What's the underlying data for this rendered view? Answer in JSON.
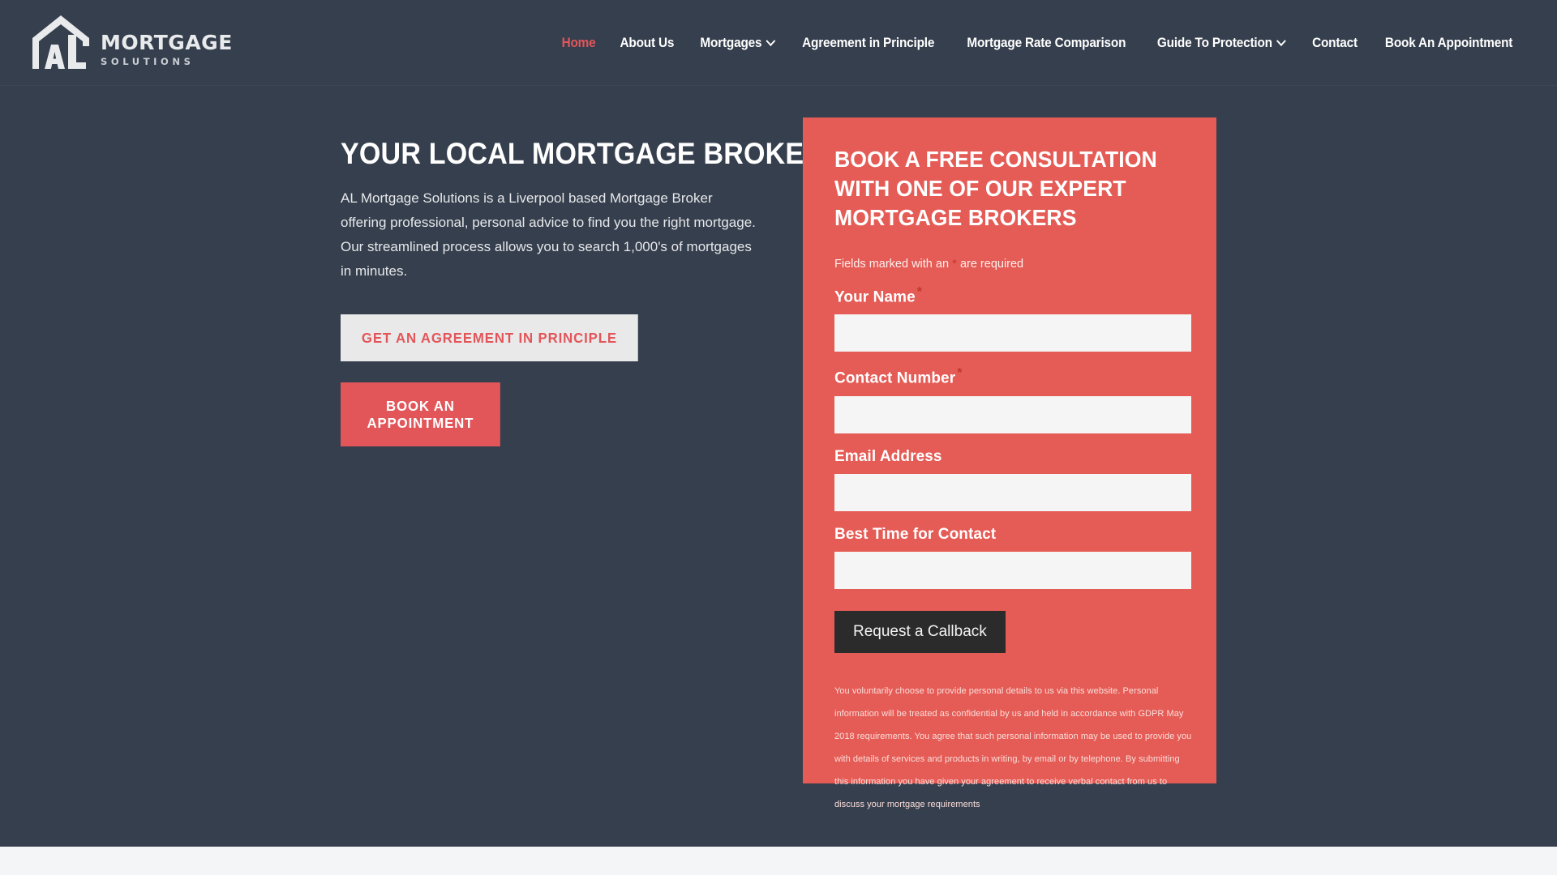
{
  "brand": {
    "logo_icon": "house-outline-al-monogram-icon",
    "name": "MORTGAGE",
    "tagline": "SOLUTIONS",
    "accent_color": "#e2565a",
    "panel_color": "#e55b55",
    "dark_color": "#363f4d"
  },
  "nav": {
    "items": [
      {
        "label": "Home",
        "active": true,
        "has_dropdown": false
      },
      {
        "label": "About Us",
        "active": false,
        "has_dropdown": false
      },
      {
        "label": "Mortgages",
        "active": false,
        "has_dropdown": true
      },
      {
        "label": "Agreement in Principle",
        "active": false,
        "has_dropdown": false
      },
      {
        "label": "Mortgage Rate Comparison",
        "active": false,
        "has_dropdown": false
      },
      {
        "label": "Guide To Protection",
        "active": false,
        "has_dropdown": true
      },
      {
        "label": "Contact",
        "active": false,
        "has_dropdown": false
      },
      {
        "label": "Book An Appointment",
        "active": false,
        "has_dropdown": false
      }
    ]
  },
  "hero": {
    "title": "YOUR LOCAL MORTGAGE BROKER",
    "paragraph": "AL Mortgage Solutions is a Liverpool based Mortgage Broker offering professional, personal advice to find you the right mortgage. Our streamlined process allows you to search 1,000's of mortgages in minutes.",
    "primary_button": "GET AN AGREEMENT IN PRINCIPLE",
    "secondary_button": "BOOK AN APPOINTMENT"
  },
  "form": {
    "title": "BOOK A FREE CONSULTATION WITH ONE OF OUR EXPERT MORTGAGE BROKERS",
    "required_note_before": "Fields marked with an",
    "required_star": "*",
    "required_note_after": "are required",
    "fields": [
      {
        "label": "Your Name",
        "required": true,
        "value": "",
        "placeholder": ""
      },
      {
        "label": "Contact Number",
        "required": true,
        "value": "",
        "placeholder": ""
      },
      {
        "label": "Email Address",
        "required": false,
        "value": "",
        "placeholder": ""
      },
      {
        "label": "Best Time for Contact",
        "required": false,
        "value": "",
        "placeholder": ""
      }
    ],
    "submit_label": "Request a Callback",
    "gdpr_text": "You voluntarily choose to provide personal details to us via this website. Personal information will be treated as confidential by us and held in accordance with GDPR May 2018 requirements.  You agree that such personal information may be used to provide you with details of services and products in writing, by email or by telephone. By submitting this information you have given your agreement to receive verbal contact from us to discuss your mortgage requirements"
  }
}
